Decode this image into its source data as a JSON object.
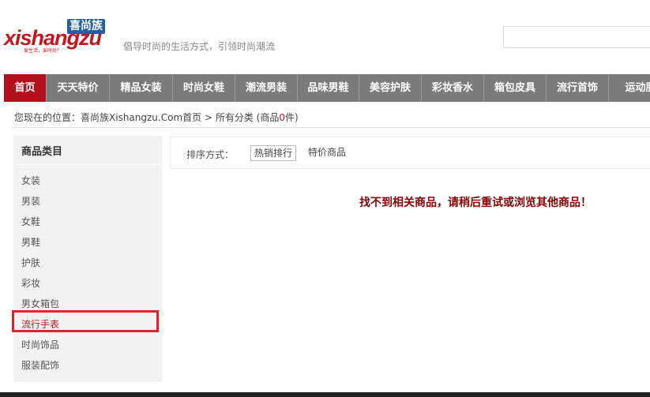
{
  "logo": {
    "wordmark": "xishangzu",
    "brand_cn": "喜尚族",
    "tagline": "爱生活，爱时尚！"
  },
  "header": {
    "slogan": "倡导时尚的生活方式，引领时尚潮流",
    "search_placeholder": ""
  },
  "nav": {
    "items": [
      {
        "label": "首页",
        "active": true
      },
      {
        "label": "天天特价"
      },
      {
        "label": "精品女装"
      },
      {
        "label": "时尚女鞋"
      },
      {
        "label": "潮流男装"
      },
      {
        "label": "品味男鞋"
      },
      {
        "label": "美容护肤"
      },
      {
        "label": "彩妆香水"
      },
      {
        "label": "箱包皮具"
      },
      {
        "label": "流行首饰"
      },
      {
        "label": "运动服"
      }
    ]
  },
  "breadcrumb": {
    "prefix": "您现在的位置：",
    "home": "喜尚族Xishangzu.Com首页",
    "sep": " > ",
    "current": "所有分类",
    "count_open": " (商品",
    "count": "0",
    "count_close": "件)"
  },
  "sidebar": {
    "title": "商品类目",
    "items": [
      {
        "label": "女装"
      },
      {
        "label": "男装"
      },
      {
        "label": "女鞋"
      },
      {
        "label": "男鞋"
      },
      {
        "label": "护肤"
      },
      {
        "label": "彩妆"
      },
      {
        "label": "男女箱包"
      },
      {
        "label": "流行手表",
        "highlighted": true
      },
      {
        "label": "时尚饰品"
      },
      {
        "label": "服装配饰"
      }
    ]
  },
  "sort": {
    "label": "排序方式：",
    "options": [
      {
        "label": "热销排行",
        "active": true
      },
      {
        "label": "特价商品"
      }
    ]
  },
  "main": {
    "empty_message": "找不到相关商品，请稍后重试或浏览其他商品！"
  },
  "colors": {
    "accent": "#b3121c",
    "nav_bg": "#7b7b7b",
    "highlight_border": "#e3212b",
    "message": "#8b0000"
  }
}
